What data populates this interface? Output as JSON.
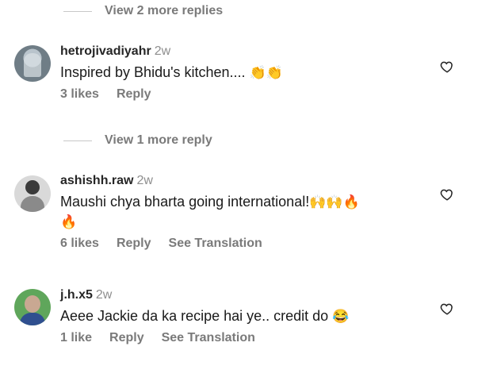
{
  "thread1": {
    "view_more": "View 2 more replies"
  },
  "comments": [
    {
      "username": "hetrojivadiyahr",
      "time": "2w",
      "text": "Inspired by Bhidu's kitchen....",
      "emoji": "👏👏",
      "likes": "3 likes",
      "reply": "Reply"
    },
    {
      "username": "ashishh.raw",
      "time": "2w",
      "text": "Maushi chya bharta going international!",
      "emoji": "🙌🙌🔥",
      "emoji2": "🔥",
      "likes": "6 likes",
      "reply": "Reply",
      "translation": "See Translation"
    },
    {
      "username": "j.h.x5",
      "time": "2w",
      "text": "Aeee Jackie da ka recipe hai ye.. credit do",
      "emoji": "😂",
      "likes": "1 like",
      "reply": "Reply",
      "translation": "See Translation"
    }
  ],
  "thread2": {
    "view_more": "View 1 more reply"
  },
  "icons": {
    "avatar": "avatar-icon",
    "like": "heart-icon"
  }
}
